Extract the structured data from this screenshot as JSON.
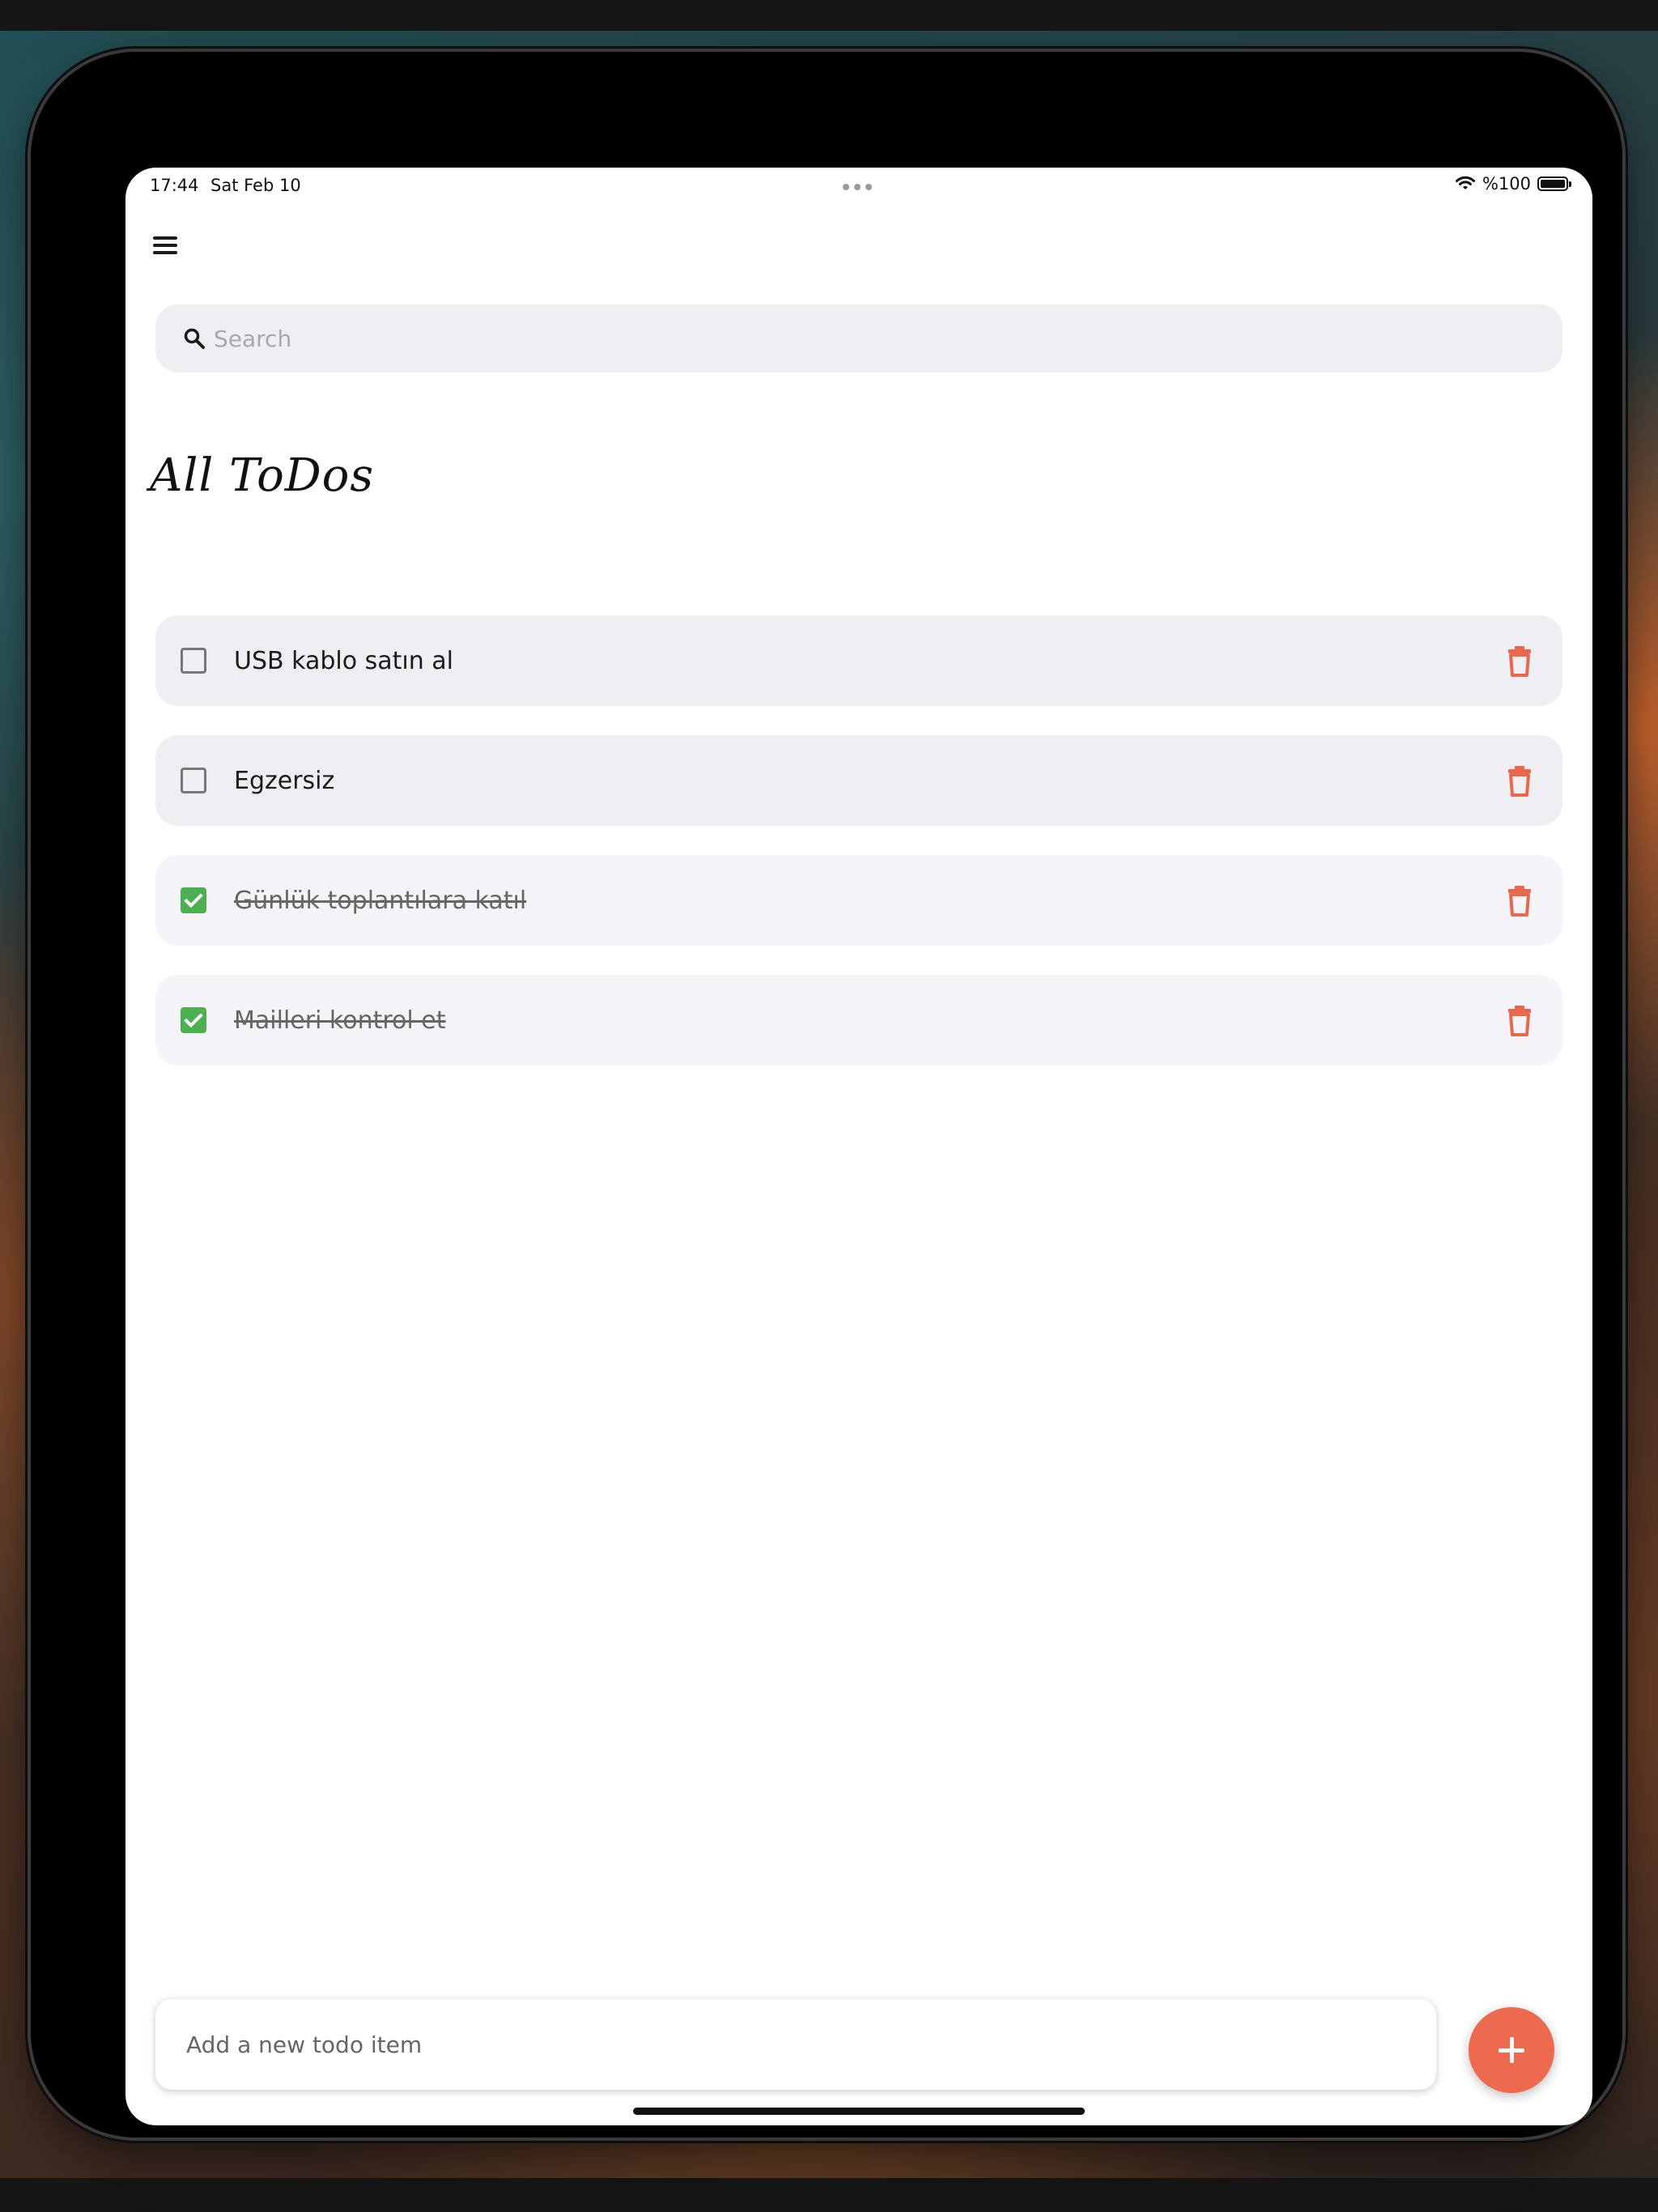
{
  "status_bar": {
    "time": "17:44",
    "date": "Sat Feb 10",
    "battery": "%100"
  },
  "search": {
    "placeholder": "Search"
  },
  "heading": "All ToDos",
  "todos": [
    {
      "label": "USB kablo satın al",
      "done": false
    },
    {
      "label": "Egzersiz",
      "done": false
    },
    {
      "label": "Günlük toplantılara katıl",
      "done": true
    },
    {
      "label": "Mailleri kontrol et",
      "done": true
    }
  ],
  "add_todo": {
    "placeholder": "Add a new todo item"
  },
  "colors": {
    "accent": "#ee6a4f",
    "checked": "#4caf50",
    "item_background": "#eeeef3",
    "trash": "#e8684d"
  },
  "icons": [
    "menu-icon",
    "search-icon",
    "trash-icon",
    "plus-icon",
    "wifi-icon",
    "battery-icon"
  ]
}
